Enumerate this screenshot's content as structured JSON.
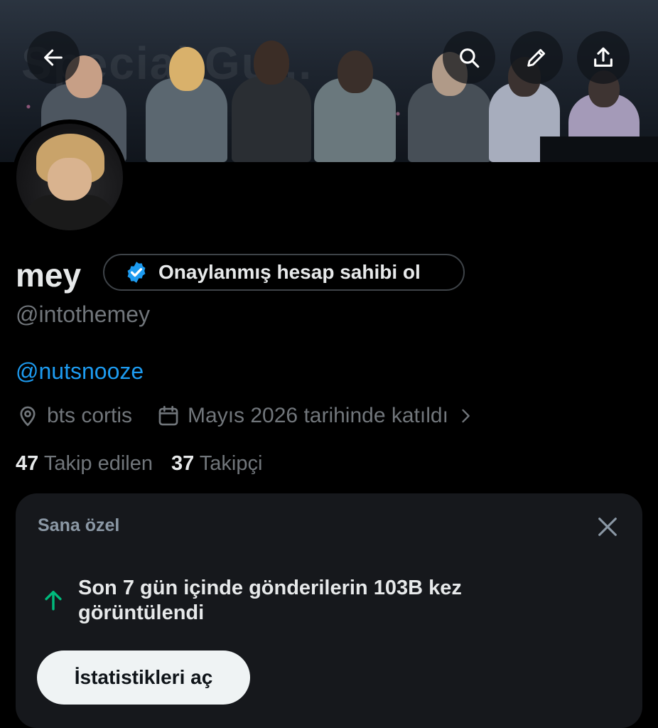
{
  "banner": {
    "background_text": "Special Gu...",
    "buttons": {
      "back": "back-arrow-icon",
      "search": "search-icon",
      "edit": "pencil-icon",
      "share": "share-icon"
    }
  },
  "profile": {
    "name": "mey",
    "verify_label": "Onaylanmış hesap sahibi ol",
    "handle": "@intothemey",
    "bio_mention": "@nutsnooze",
    "location": "bts cortis",
    "joined": "Mayıs 2026 tarihinde katıldı",
    "following_count": "47",
    "following_label": "Takip edilen",
    "followers_count": "37",
    "followers_label": "Takipçi"
  },
  "card": {
    "title": "Sana özel",
    "message": "Son 7 gün içinde gönderilerin 103B kez görüntülendi",
    "button_label": "İstatistikleri aç"
  },
  "colors": {
    "background": "#000000",
    "accent": "#1d9bf0",
    "muted": "#71767b",
    "card_bg": "#16181c",
    "up_arrow": "#00ba7c"
  }
}
